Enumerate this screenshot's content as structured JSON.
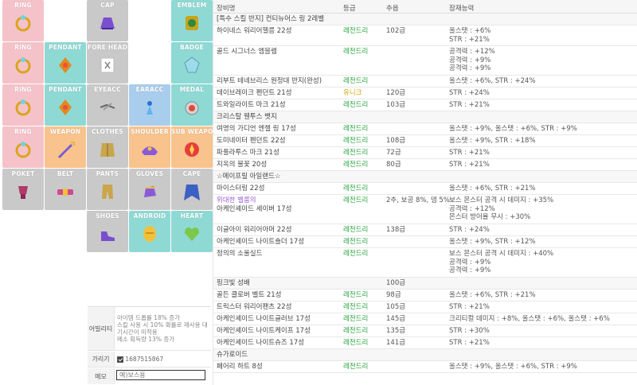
{
  "colors": {
    "pink": "#f5c2c9",
    "teal": "#8fd9d4",
    "gray": "#c9c9c9",
    "blue": "#a9cdec",
    "orange": "#f8c38c",
    "legendary": "#27a33d",
    "unique": "#d5a300",
    "purple": "#9b5bd6"
  },
  "equipment": [
    {
      "label": "RING",
      "color": "pink",
      "icon": "ring-icon"
    },
    {
      "label": "",
      "color": "empty",
      "icon": ""
    },
    {
      "label": "CAP",
      "color": "gray",
      "icon": "cap-icon"
    },
    {
      "label": "",
      "color": "empty",
      "icon": ""
    },
    {
      "label": "EMBLEM",
      "color": "teal",
      "icon": "emblem-icon"
    },
    {
      "label": "RING",
      "color": "pink",
      "icon": "ring-icon"
    },
    {
      "label": "PENDANT",
      "color": "teal",
      "icon": "pendant-icon"
    },
    {
      "label": "FORE HEAD",
      "color": "gray",
      "icon": "forehead-icon"
    },
    {
      "label": "",
      "color": "empty",
      "icon": ""
    },
    {
      "label": "BADGE",
      "color": "teal",
      "icon": "badge-icon"
    },
    {
      "label": "RING",
      "color": "pink",
      "icon": "ring-icon"
    },
    {
      "label": "PENDANT",
      "color": "teal",
      "icon": "pendant-icon"
    },
    {
      "label": "EYEACC",
      "color": "gray",
      "icon": "eye-accessory-icon"
    },
    {
      "label": "EARACC",
      "color": "blue",
      "icon": "earring-icon"
    },
    {
      "label": "MEDAL",
      "color": "teal",
      "icon": "medal-icon"
    },
    {
      "label": "RING",
      "color": "pink",
      "icon": "ring-icon"
    },
    {
      "label": "WEAPON",
      "color": "orange",
      "icon": "weapon-icon"
    },
    {
      "label": "CLOTHES",
      "color": "gray",
      "icon": "clothes-icon"
    },
    {
      "label": "SHOULDER",
      "color": "orange",
      "icon": "shoulder-icon"
    },
    {
      "label": "SUB WEAPON",
      "color": "orange",
      "icon": "subweapon-icon"
    },
    {
      "label": "POKET",
      "color": "gray",
      "icon": "pocket-icon"
    },
    {
      "label": "BELT",
      "color": "gray",
      "icon": "belt-icon"
    },
    {
      "label": "PANTS",
      "color": "gray",
      "icon": "pants-icon"
    },
    {
      "label": "GLOVES",
      "color": "gray",
      "icon": "gloves-icon"
    },
    {
      "label": "CAPE",
      "color": "gray",
      "icon": "cape-icon"
    },
    {
      "label": "",
      "color": "empty",
      "icon": ""
    },
    {
      "label": "",
      "color": "empty",
      "icon": ""
    },
    {
      "label": "SHOES",
      "color": "gray",
      "icon": "shoes-icon"
    },
    {
      "label": "ANDROID",
      "color": "teal",
      "icon": "android-icon"
    },
    {
      "label": "HEART",
      "color": "teal",
      "icon": "heart-icon"
    }
  ],
  "info": {
    "ability_label": "어빌리티",
    "ability_lines": [
      "아이템 드롭률 18% 증가",
      "스킬 사용 시 10% 확률로 재사용 대기시간이 미적용",
      "메소 획득량 13% 증가"
    ],
    "hide_label": "가리기",
    "hide_value": "1687515867",
    "memo_label": "메모",
    "memo_placeholder": "예)보스용"
  },
  "table": {
    "headers": [
      "장비명",
      "등급",
      "추옵",
      "잠재능력"
    ],
    "rows": [
      {
        "name": "[특수 스킬 반지] 컨티뉴어스 링 2레벨",
        "grade": "",
        "star": "",
        "pot": [],
        "section": true
      },
      {
        "name": "하이네스 워리어헬름 22성",
        "grade": "레전드리",
        "star": "102급",
        "pot": [
          "올스탯 : +6%",
          "STR : +21%"
        ]
      },
      {
        "name": "골드 시그너스 엠블렘",
        "grade": "레전드리",
        "star": "",
        "pot": [
          "공격력 : +12%",
          "공격력 : +9%",
          "공격력 : +9%"
        ]
      },
      {
        "name": "리부트 테네브리스 원정대 반지(완성)",
        "grade": "레전드리",
        "star": "",
        "pot": [
          "올스탯 : +6%, STR : +24%"
        ]
      },
      {
        "name": "데이브레이크 펜던트 21성",
        "grade": "유니크",
        "gradeClass": "unique",
        "star": "120급",
        "pot": [
          "STR : +24%"
        ]
      },
      {
        "name": "트와일라이트 마크 21성",
        "grade": "레전드리",
        "star": "103급",
        "pot": [
          "STR : +21%"
        ]
      },
      {
        "name": "크리스탈 웬투스 뱃지",
        "grade": "",
        "star": "",
        "pot": [],
        "section": true
      },
      {
        "name": "여명의 가디언 엔젤 링 17성",
        "grade": "레전드리",
        "star": "",
        "pot": [
          "올스탯 : +9%, 올스탯 : +6%, STR : +9%"
        ]
      },
      {
        "name": "도미네이터 펜던트 22성",
        "grade": "레전드리",
        "star": "108급",
        "pot": [
          "올스탯 : +9%, STR : +18%"
        ]
      },
      {
        "name": "파풀라투스 마크 21성",
        "grade": "레전드리",
        "star": "72급",
        "pot": [
          "STR : +21%"
        ]
      },
      {
        "name": "지옥의 불꽃 20성",
        "grade": "레전드리",
        "star": "80급",
        "pot": [
          "STR : +21%"
        ]
      },
      {
        "name": "☆메이프릴 아일랜드☆",
        "grade": "",
        "star": "",
        "pot": [],
        "section": true
      },
      {
        "name": "마이스터링 22성",
        "grade": "레전드리",
        "star": "",
        "pot": [
          "올스탯 : +6%, STR : +21%"
        ]
      },
      {
        "name": "위대한 벨룸의|아케인셰이드 세이버 17성",
        "grade": "레전드리",
        "star": "2추, 보공 8%, 뎀 5%",
        "pot": [
          "보스 몬스터 공격 시 데미지 : +35%",
          "공격력 : +12%",
          "몬스터 방어율 무시 : +30%"
        ],
        "purpleFirst": true
      },
      {
        "name": "이글아이 워리어아머 22성",
        "grade": "레전드리",
        "star": "138급",
        "pot": [
          "STR : +24%"
        ]
      },
      {
        "name": "아케인셰이드 나이트숄더 17성",
        "grade": "레전드리",
        "star": "",
        "pot": [
          "올스탯 : +9%, STR : +12%"
        ]
      },
      {
        "name": "정의의 소울실드",
        "grade": "레전드리",
        "star": "",
        "pot": [
          "보스 몬스터 공격 시 데미지 : +40%",
          "공격력 : +9%",
          "공격력 : +9%"
        ]
      },
      {
        "name": "핑크빛 성배",
        "grade": "",
        "star": "100급",
        "pot": [],
        "section": true
      },
      {
        "name": "골든 클로버 벨트 21성",
        "grade": "레전드리",
        "star": "98급",
        "pot": [
          "올스탯 : +6%, STR : +21%"
        ]
      },
      {
        "name": "트릭스터 워리어팬츠 22성",
        "grade": "레전드리",
        "star": "105급",
        "pot": [
          "STR : +21%"
        ]
      },
      {
        "name": "아케인셰이드 나이트글러브 17성",
        "grade": "레전드리",
        "star": "145급",
        "pot": [
          "크리티컬 데미지 : +8%, 올스탯 : +6%, 올스탯 : +6%"
        ]
      },
      {
        "name": "아케인셰이드 나이트케이프 17성",
        "grade": "레전드리",
        "star": "135급",
        "pot": [
          "STR : +30%"
        ]
      },
      {
        "name": "아케인셰이드 나이트슈즈 17성",
        "grade": "레전드리",
        "star": "141급",
        "pot": [
          "STR : +21%"
        ]
      },
      {
        "name": "슈가로이드",
        "grade": "",
        "star": "",
        "pot": [],
        "section": true
      },
      {
        "name": "페어리 하트 8성",
        "grade": "레전드리",
        "star": "",
        "pot": [
          "올스탯 : +9%, 올스탯 : +6%, STR : +9%"
        ]
      }
    ]
  }
}
